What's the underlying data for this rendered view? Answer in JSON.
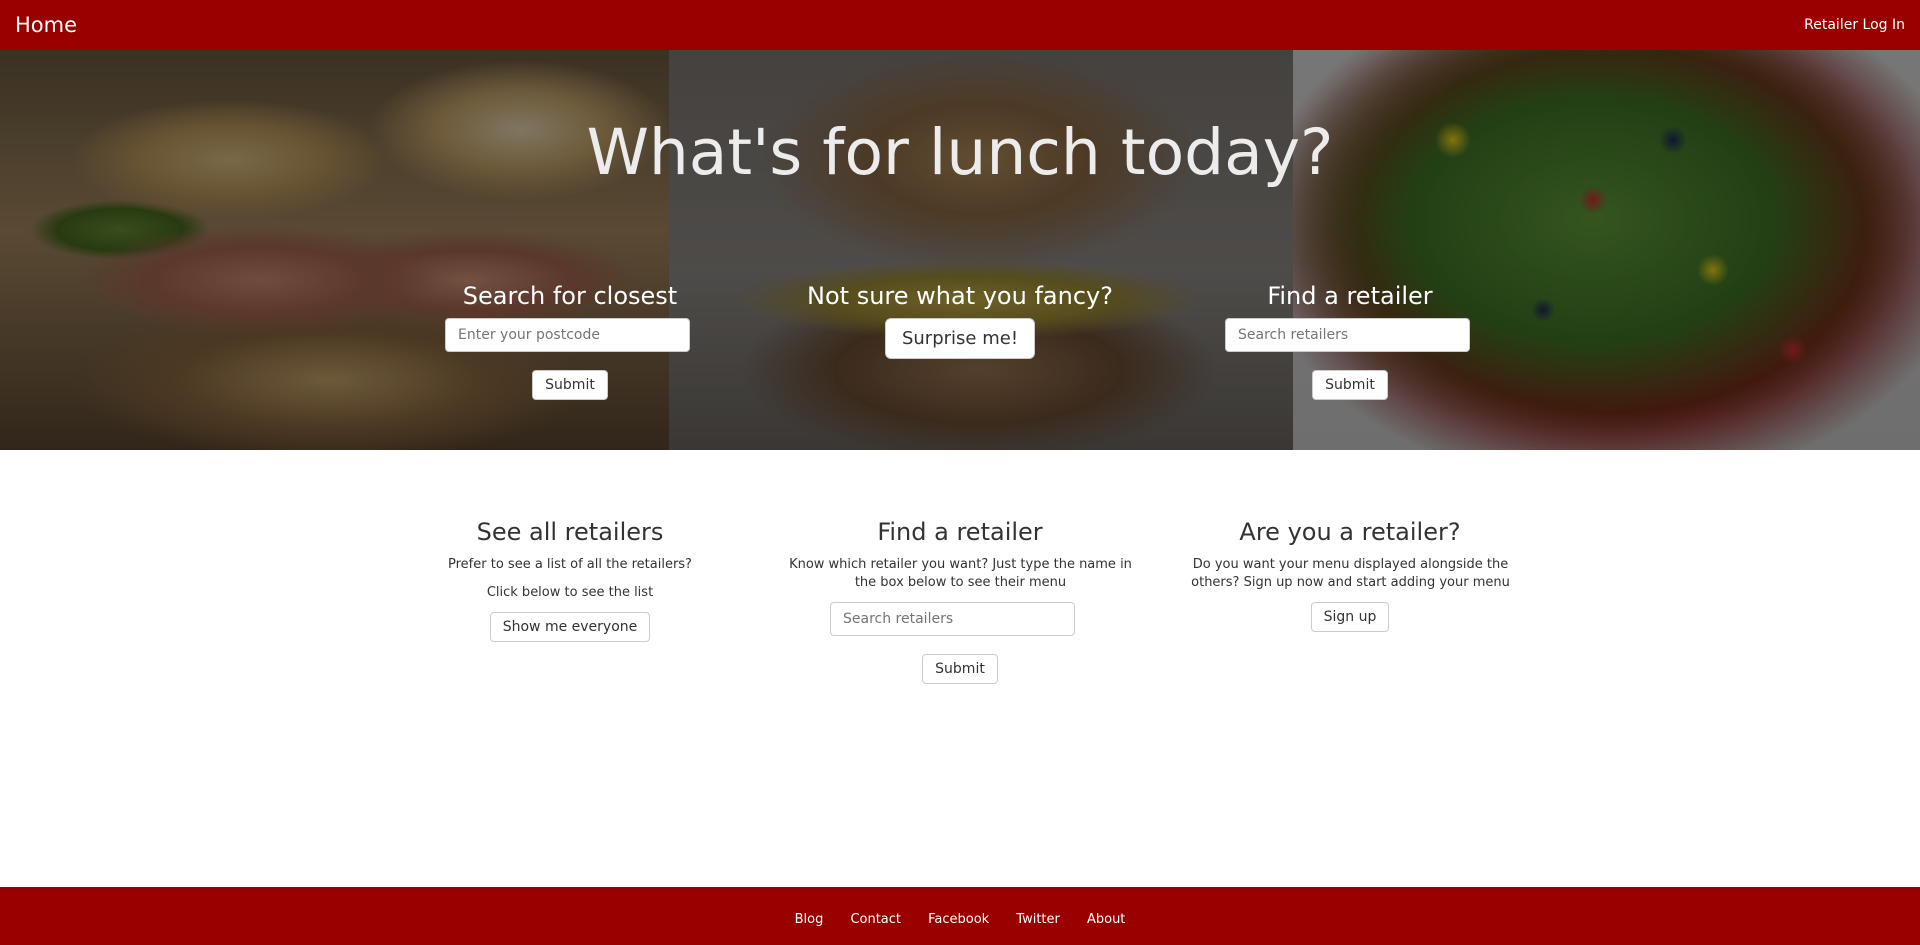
{
  "navbar": {
    "brand": "Home",
    "login": "Retailer Log In"
  },
  "hero": {
    "title": "What's for lunch today?",
    "search_closest": {
      "heading": "Search for closest",
      "placeholder": "Enter your postcode",
      "button": "Submit"
    },
    "surprise": {
      "heading": "Not sure what you fancy?",
      "button": "Surprise me!"
    },
    "find_retailer": {
      "heading": "Find a retailer",
      "placeholder": "Search retailers",
      "button": "Submit"
    }
  },
  "info": {
    "see_all": {
      "heading": "See all retailers",
      "text1": "Prefer to see a list of all the retailers?",
      "text2": "Click below to see the list",
      "button": "Show me everyone"
    },
    "find": {
      "heading": "Find a retailer",
      "text": "Know which retailer you want? Just type the name in the box below to see their menu",
      "placeholder": "Search retailers",
      "button": "Submit"
    },
    "are_you": {
      "heading": "Are you a retailer?",
      "text": "Do you want your menu displayed alongside the others? Sign up now and start adding your menu",
      "button": "Sign up"
    }
  },
  "footer": {
    "links": [
      "Blog",
      "Contact",
      "Facebook",
      "Twitter",
      "About"
    ]
  },
  "colors": {
    "brand_red": "#990000",
    "text": "#333333"
  }
}
